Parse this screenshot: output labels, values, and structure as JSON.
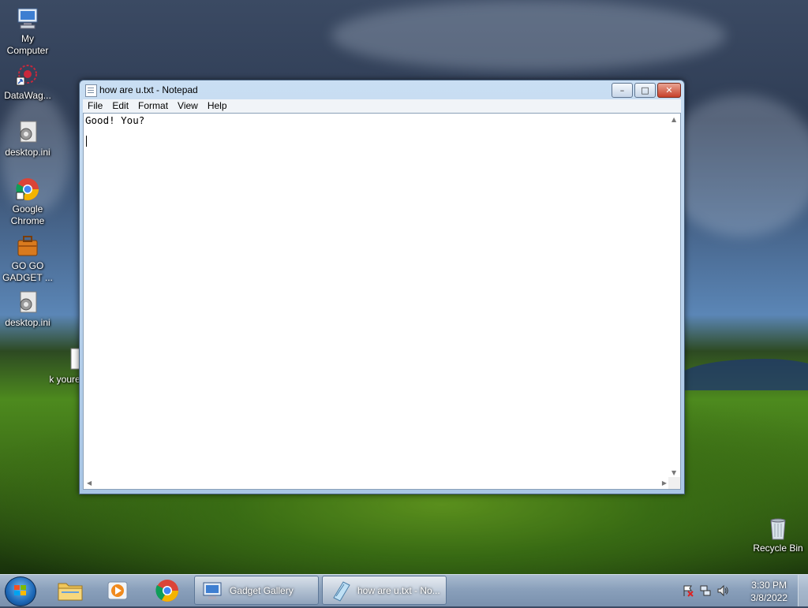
{
  "desktop": {
    "icons": [
      {
        "label": "My Computer",
        "icon": "computer-icon"
      },
      {
        "label": "DataWag...",
        "icon": "datawagon-shortcut-icon"
      },
      {
        "label": "desktop.ini",
        "icon": "settings-file-icon"
      },
      {
        "label": "Google Chrome",
        "icon": "chrome-icon"
      },
      {
        "label": "GO GO GADGET ...",
        "icon": "briefcase-icon"
      },
      {
        "label": "desktop.ini",
        "icon": "settings-file-icon"
      },
      {
        "label": "k youre",
        "icon": "text-file-icon"
      }
    ],
    "recycle_bin": {
      "label": "Recycle Bin",
      "icon": "recycle-bin-icon"
    }
  },
  "notepad": {
    "title": "how are u.txt - Notepad",
    "menu": [
      "File",
      "Edit",
      "Format",
      "View",
      "Help"
    ],
    "content": "Good! You?\n"
  },
  "taskbar": {
    "start_icon": "windows-start-icon",
    "pinned": [
      {
        "name": "file-explorer",
        "icon": "folder-icon"
      },
      {
        "name": "media-player",
        "icon": "play-icon"
      },
      {
        "name": "chrome",
        "icon": "chrome-icon"
      }
    ],
    "tasks": [
      {
        "label": "Gadget Gallery",
        "icon": "gadget-gallery-icon"
      },
      {
        "label": "how are u.txt - No...",
        "icon": "notepad-icon",
        "active": true
      }
    ],
    "tray": {
      "icons": [
        "action-center-flag-icon",
        "network-icon",
        "volume-icon"
      ],
      "time": "3:30 PM",
      "date": "3/8/2022"
    }
  }
}
